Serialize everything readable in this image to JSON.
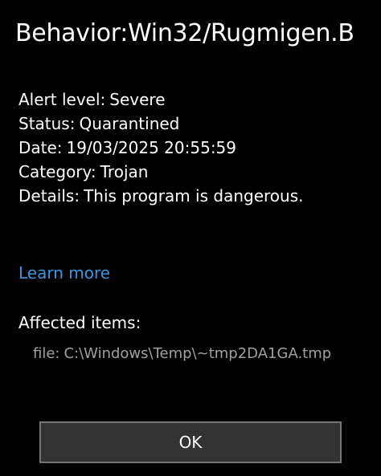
{
  "dialog": {
    "title": "Behavior:Win32/Rugmigen.B",
    "details": [
      {
        "label": "Alert level:",
        "value": "Severe"
      },
      {
        "label": "Status:",
        "value": "Quarantined"
      },
      {
        "label": "Date:",
        "value": "19/03/2025 20:55:59"
      },
      {
        "label": "Category:",
        "value": "Trojan"
      },
      {
        "label": "Details:",
        "value": "This program is dangerous."
      }
    ],
    "learn_more_label": "Learn more",
    "affected_heading": "Affected items:",
    "affected_items": [
      {
        "type": "file:",
        "path": "C:\\Windows\\Temp\\~tmp2DA1GA.tmp"
      }
    ],
    "ok_label": "OK"
  },
  "colors": {
    "background": "#000000",
    "text": "#ffffff",
    "link": "#3a96dd",
    "muted_text": "#a0a0a0",
    "button_background": "#333333",
    "button_border": "#767676"
  }
}
